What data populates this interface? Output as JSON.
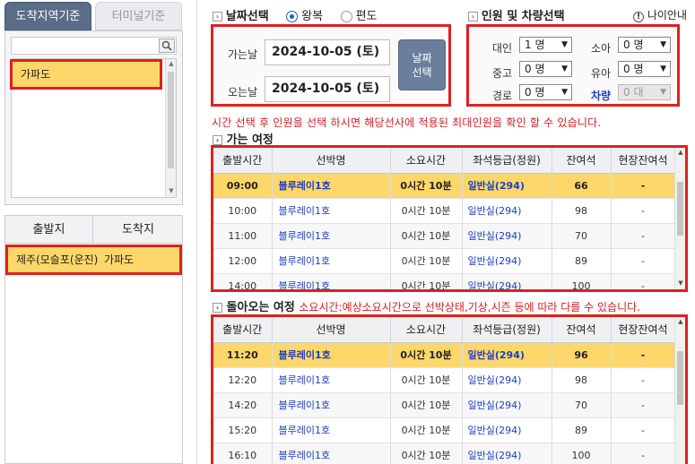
{
  "left": {
    "tabs": [
      {
        "label": "도착지역기준"
      },
      {
        "label": "터미널기준"
      }
    ],
    "search": {
      "placeholder": ""
    },
    "region_list": [
      {
        "label": "가파도"
      }
    ],
    "route_header": {
      "from": "출발지",
      "to": "도착지"
    },
    "route_row": {
      "from": "제주(모슬포(운진)",
      "to": "가파도"
    }
  },
  "date_section": {
    "title": "날짜선택",
    "trip_options": [
      {
        "label": "왕복",
        "selected": true
      },
      {
        "label": "편도",
        "selected": false
      }
    ],
    "depart_label": "가는날",
    "depart_value": "2024-10-05 (토)",
    "return_label": "오는날",
    "return_value": "2024-10-05 (토)",
    "select_button": "날짜 선택"
  },
  "pax_section": {
    "title": "인원 및 차량선택",
    "guide_link": "나이안내",
    "adult": {
      "label": "대인",
      "value": "1 명"
    },
    "youth": {
      "label": "중고",
      "value": "0 명"
    },
    "senior": {
      "label": "경로",
      "value": "0 명"
    },
    "child": {
      "label": "소아",
      "value": "0 명"
    },
    "infant": {
      "label": "유아",
      "value": "0 명"
    },
    "vehicle": {
      "label": "차량",
      "value": "0 대"
    }
  },
  "notice": "시간 선택 후 인원을 선택 하시면 해당선사에 적용된 최대인원을 확인 할 수 있습니다.",
  "outbound": {
    "title": "가는 여정",
    "columns": [
      "출발시간",
      "선박명",
      "소요시간",
      "좌석등급(정원)",
      "잔여석",
      "현장잔여석"
    ],
    "rows": [
      {
        "time": "09:00",
        "ship": "블루레이1호",
        "duration": "0시간 10분",
        "seat": "일반실(294)",
        "remain": "66",
        "onsite": "-"
      },
      {
        "time": "10:00",
        "ship": "블루레이1호",
        "duration": "0시간 10분",
        "seat": "일반실(294)",
        "remain": "98",
        "onsite": "-"
      },
      {
        "time": "11:00",
        "ship": "블루레이1호",
        "duration": "0시간 10분",
        "seat": "일반실(294)",
        "remain": "70",
        "onsite": "-"
      },
      {
        "time": "12:00",
        "ship": "블루레이1호",
        "duration": "0시간 10분",
        "seat": "일반실(294)",
        "remain": "89",
        "onsite": "-"
      },
      {
        "time": "14:00",
        "ship": "블루레이1호",
        "duration": "0시간 10분",
        "seat": "일반실(294)",
        "remain": "100",
        "onsite": "-"
      }
    ]
  },
  "inbound": {
    "title": "돌아오는 여정",
    "note": "소요시간:예상소요시간으로 선박상태,기상,시즌 등에 따라 다를 수 있습니다.",
    "columns": [
      "출발시간",
      "선박명",
      "소요시간",
      "좌석등급(정원)",
      "잔여석",
      "현장잔여석"
    ],
    "rows": [
      {
        "time": "11:20",
        "ship": "블루레이1호",
        "duration": "0시간 10분",
        "seat": "일반실(294)",
        "remain": "96",
        "onsite": "-"
      },
      {
        "time": "12:20",
        "ship": "블루레이1호",
        "duration": "0시간 10분",
        "seat": "일반실(294)",
        "remain": "98",
        "onsite": "-"
      },
      {
        "time": "14:20",
        "ship": "블루레이1호",
        "duration": "0시간 10분",
        "seat": "일반실(294)",
        "remain": "70",
        "onsite": "-"
      },
      {
        "time": "15:20",
        "ship": "블루레이1호",
        "duration": "0시간 10분",
        "seat": "일반실(294)",
        "remain": "89",
        "onsite": "-"
      },
      {
        "time": "16:10",
        "ship": "블루레이1호",
        "duration": "0시간 10분",
        "seat": "일반실(294)",
        "remain": "100",
        "onsite": "-"
      }
    ]
  }
}
